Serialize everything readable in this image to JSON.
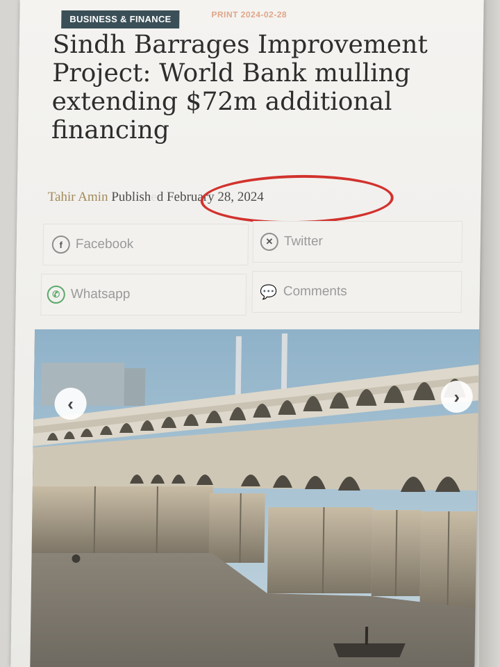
{
  "article": {
    "category": "BUSINESS & FINANCE",
    "print_label": "PRINT 2024-02-28",
    "headline": "Sindh Barrages Improvement Project: World Bank mulling extending $72m additional financing",
    "author": "Tahir Amin",
    "published_prefix": "Publish",
    "published_hidden_char": "e",
    "published_suffix": "d",
    "published_date": "February 28, 2024"
  },
  "share": {
    "facebook": "Facebook",
    "twitter": "Twitter",
    "whatsapp": "Whatsapp",
    "comments": "Comments"
  },
  "icons": {
    "facebook": "facebook-icon",
    "twitter": "x-icon",
    "whatsapp": "whatsapp-icon",
    "comments": "comments-icon",
    "prev": "chevron-left-icon",
    "next": "chevron-right-icon"
  },
  "colors": {
    "category_bg": "#3a4f57",
    "highlight_ring": "#d2322d",
    "author": "#a08a5a"
  }
}
